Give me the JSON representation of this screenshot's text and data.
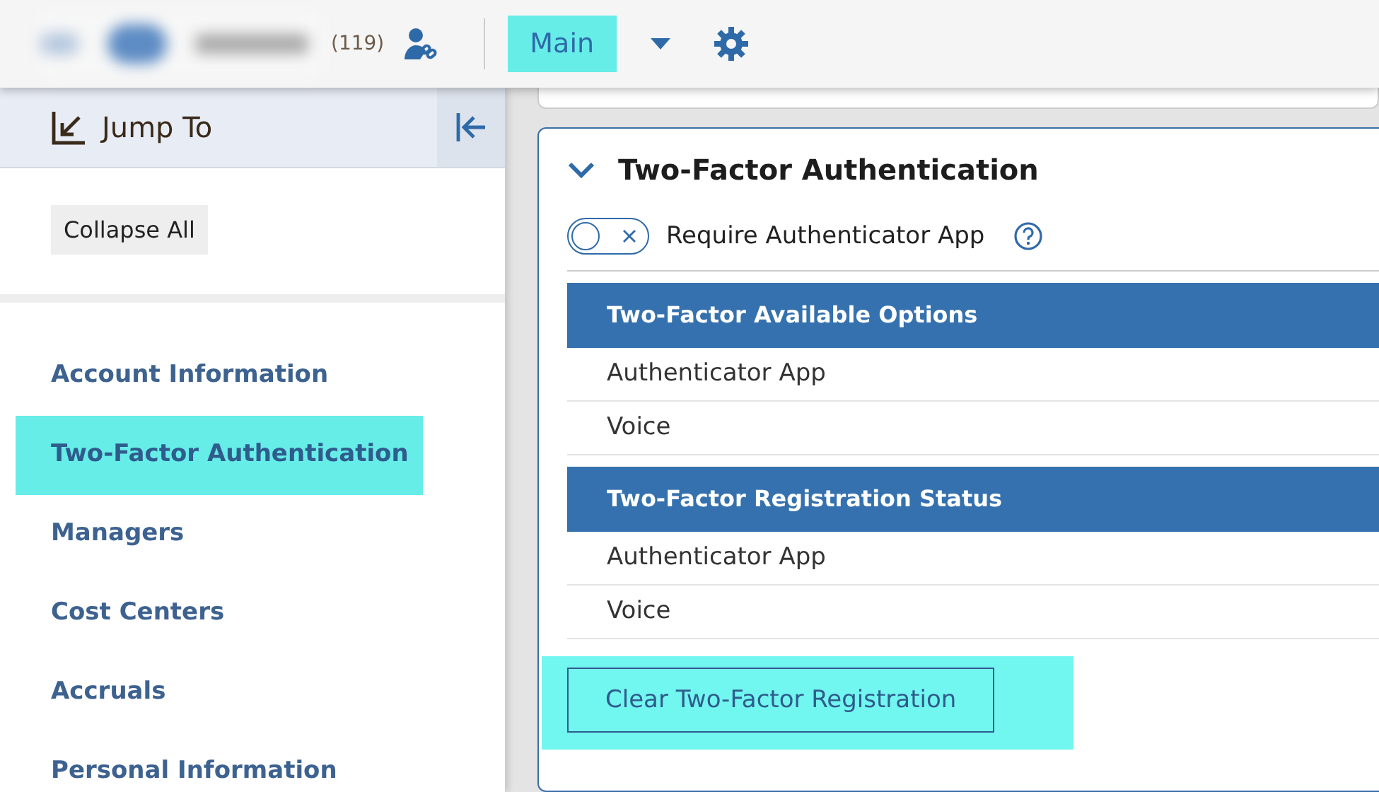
{
  "top_bar": {
    "count": "(119)",
    "view": {
      "label": "Main",
      "selected": true
    }
  },
  "sidebar": {
    "title": "Jump To",
    "collapse_all": "Collapse All",
    "items": [
      {
        "label": "Account Information",
        "selected": false
      },
      {
        "label": "Two-Factor Authentication",
        "selected": true
      },
      {
        "label": "Managers",
        "selected": false
      },
      {
        "label": "Cost Centers",
        "selected": false
      },
      {
        "label": "Accruals",
        "selected": false
      },
      {
        "label": "Personal Information",
        "selected": false
      }
    ]
  },
  "section": {
    "title": "Two-Factor Authentication",
    "expanded": true,
    "toggle": {
      "label": "Require Authenticator App",
      "on": false
    },
    "tables": [
      {
        "header": "Two-Factor Available Options",
        "rows": [
          "Authenticator App",
          "Voice"
        ]
      },
      {
        "header": "Two-Factor Registration Status",
        "rows": [
          "Authenticator App",
          "Voice"
        ]
      }
    ],
    "clear_button": {
      "label": "Clear Two-Factor Registration",
      "highlighted": true
    }
  }
}
